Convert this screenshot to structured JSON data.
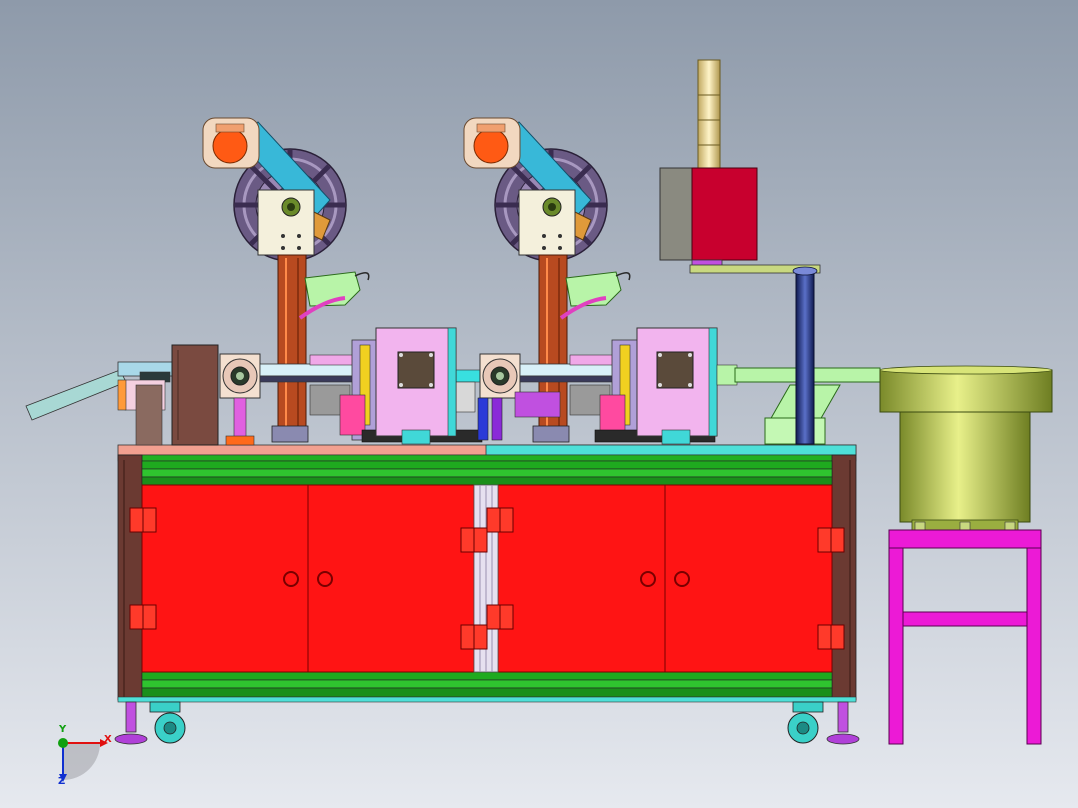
{
  "viewport": {
    "background_top": "#8e9aaa",
    "background_bottom": "#e6e9ef"
  },
  "axis_triad": {
    "x_label": "X",
    "y_label": "Y",
    "z_label": "Z",
    "x_color": "#e01010",
    "y_color": "#10a010",
    "z_color": "#1030d0"
  },
  "colors": {
    "cabinet_door": "#ff1414",
    "frame_dark": "#6b3a32",
    "frame_green": "#22b022",
    "bowl_feeder": "#b6cc48",
    "stand_magenta": "#ec1ad6",
    "reel": "#7b6a92",
    "motor_orange": "#ff5a14",
    "column_brown": "#b84a20",
    "box_pink": "#f2b4ee",
    "cylinder_red": "#c8002e",
    "tower_cream": "#f2e2a0"
  }
}
